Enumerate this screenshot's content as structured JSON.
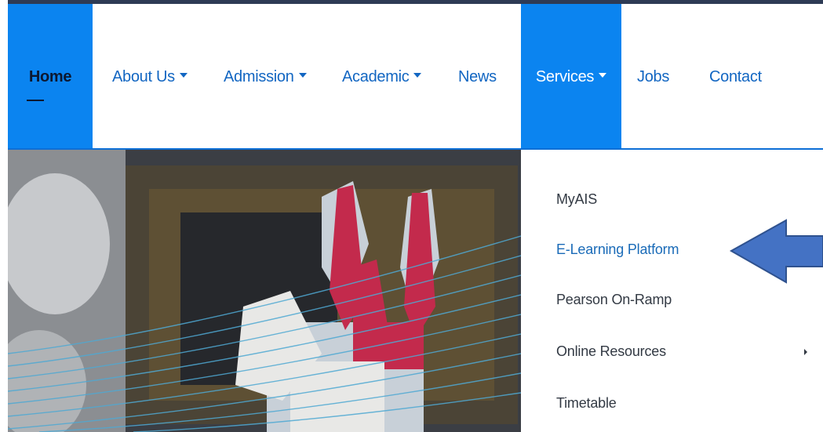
{
  "nav": {
    "items": [
      {
        "label": "Home",
        "active": true,
        "dropdown": false
      },
      {
        "label": "About Us",
        "dropdown": true
      },
      {
        "label": "Admission",
        "dropdown": true
      },
      {
        "label": "Academic",
        "dropdown": true
      },
      {
        "label": "News",
        "dropdown": false
      },
      {
        "label": "Services",
        "dropdown": true,
        "open": true
      },
      {
        "label": "Jobs",
        "dropdown": false
      },
      {
        "label": "Contact",
        "dropdown": false
      }
    ]
  },
  "services_menu": {
    "items": [
      {
        "label": "MyAIS"
      },
      {
        "label": "E-Learning Platform",
        "highlighted": true
      },
      {
        "label": "Pearson On-Ramp"
      },
      {
        "label": "Online Resources",
        "has_submenu": true
      },
      {
        "label": "Timetable"
      }
    ]
  },
  "annotation": {
    "icon": "left-arrow-callout-icon",
    "color": "#4472c4"
  },
  "colors": {
    "accent": "#0b84f0",
    "link": "#1266c2",
    "menu_link": "#1a6bb8"
  }
}
